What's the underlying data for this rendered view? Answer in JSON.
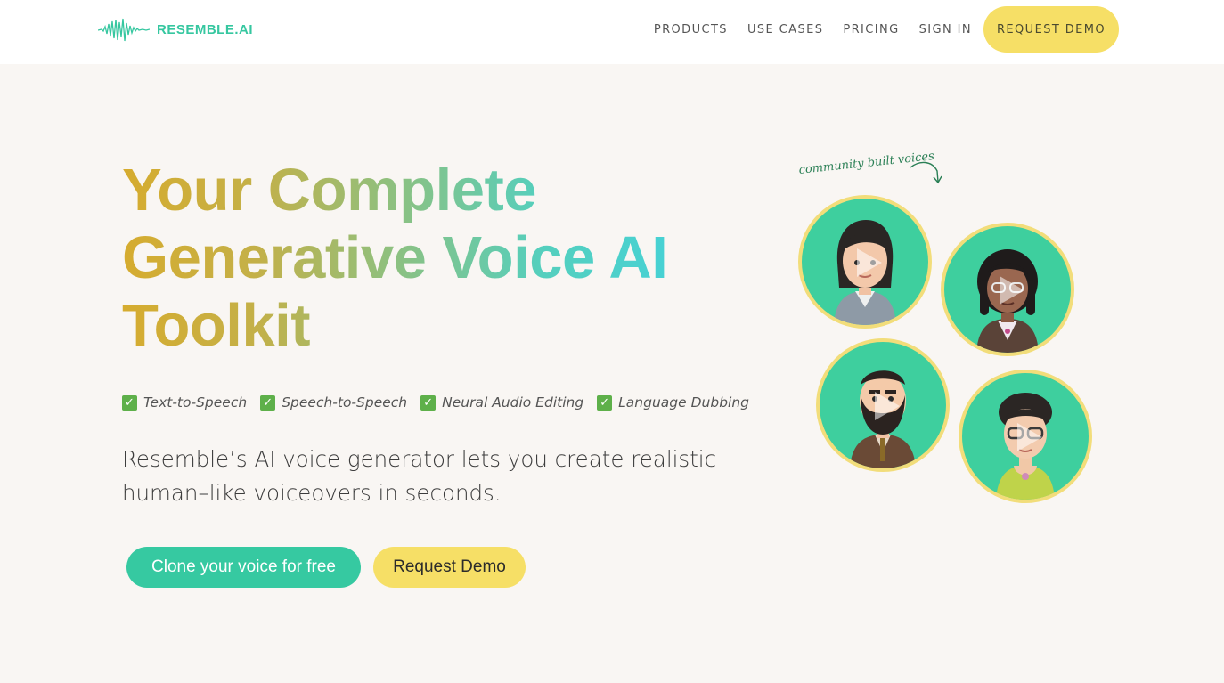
{
  "brand": {
    "name": "RESEMBLE.AI",
    "accent": "#36c9a1",
    "yellow": "#f6df66"
  },
  "nav": {
    "items": [
      {
        "label": "PRODUCTS"
      },
      {
        "label": "USE CASES"
      },
      {
        "label": "PRICING"
      },
      {
        "label": "SIGN IN"
      }
    ],
    "cta_label": "REQUEST DEMO"
  },
  "hero": {
    "headline_line1_a": "Your ",
    "headline_line1_b": "Complete",
    "headline_line2_a": "Generative ",
    "headline_line2_b": "Voice ",
    "headline_line2_c": "AI",
    "headline_line3": "Toolkit",
    "features": [
      {
        "label": "Text-to-Speech"
      },
      {
        "label": "Speech-to-Speech"
      },
      {
        "label": "Neural Audio Editing"
      },
      {
        "label": "Language Dubbing"
      }
    ],
    "subtitle": "Resemble’s AI voice generator lets you create realistic human–like voiceovers in seconds.",
    "primary_button": "Clone your voice for free",
    "secondary_button": "Request Demo"
  },
  "voices": {
    "caption": "community built voices",
    "avatars": [
      {
        "icon": "avatar-woman-dark-hair"
      },
      {
        "icon": "avatar-woman-curly-hair-glasses"
      },
      {
        "icon": "avatar-man-beard"
      },
      {
        "icon": "avatar-woman-glasses"
      }
    ],
    "play_icon": "play-icon"
  }
}
